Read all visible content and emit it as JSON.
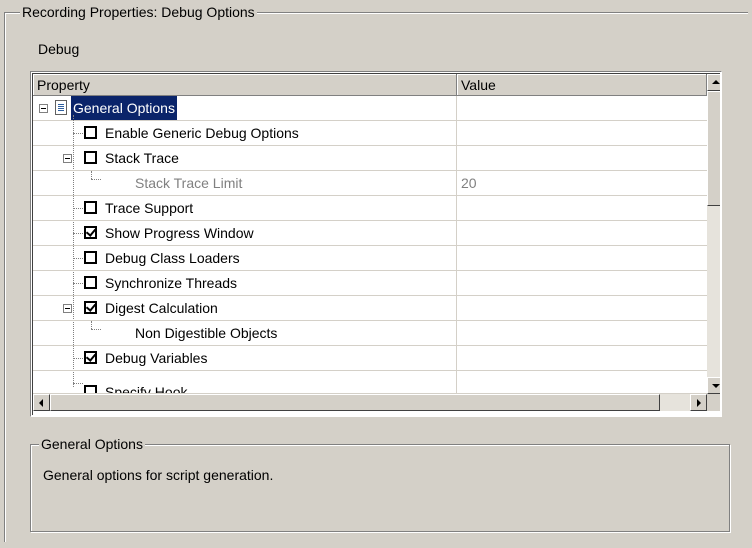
{
  "group_title": "Recording Properties: Debug Options",
  "section_label": "Debug",
  "grid": {
    "columns": {
      "property": "Property",
      "value": "Value"
    },
    "rows": [
      {
        "label": "General Options",
        "value": "",
        "selected": true
      },
      {
        "label": "Enable Generic Debug Options",
        "value": "",
        "checked": false
      },
      {
        "label": "Stack Trace",
        "value": "",
        "checked": false
      },
      {
        "label": "Stack Trace Limit",
        "value": "20"
      },
      {
        "label": "Trace Support",
        "value": "",
        "checked": false
      },
      {
        "label": "Show Progress Window",
        "value": "",
        "checked": true
      },
      {
        "label": "Debug Class Loaders",
        "value": "",
        "checked": false
      },
      {
        "label": "Synchronize Threads",
        "value": "",
        "checked": false
      },
      {
        "label": "Digest Calculation",
        "value": "",
        "checked": true
      },
      {
        "label": "Non Digestible Objects",
        "value": ""
      },
      {
        "label": "Debug Variables",
        "value": "",
        "checked": true
      },
      {
        "label": "Specify Hook",
        "value": "",
        "checked": false
      }
    ]
  },
  "description": {
    "title": "General Options",
    "text": "General options for script generation."
  }
}
